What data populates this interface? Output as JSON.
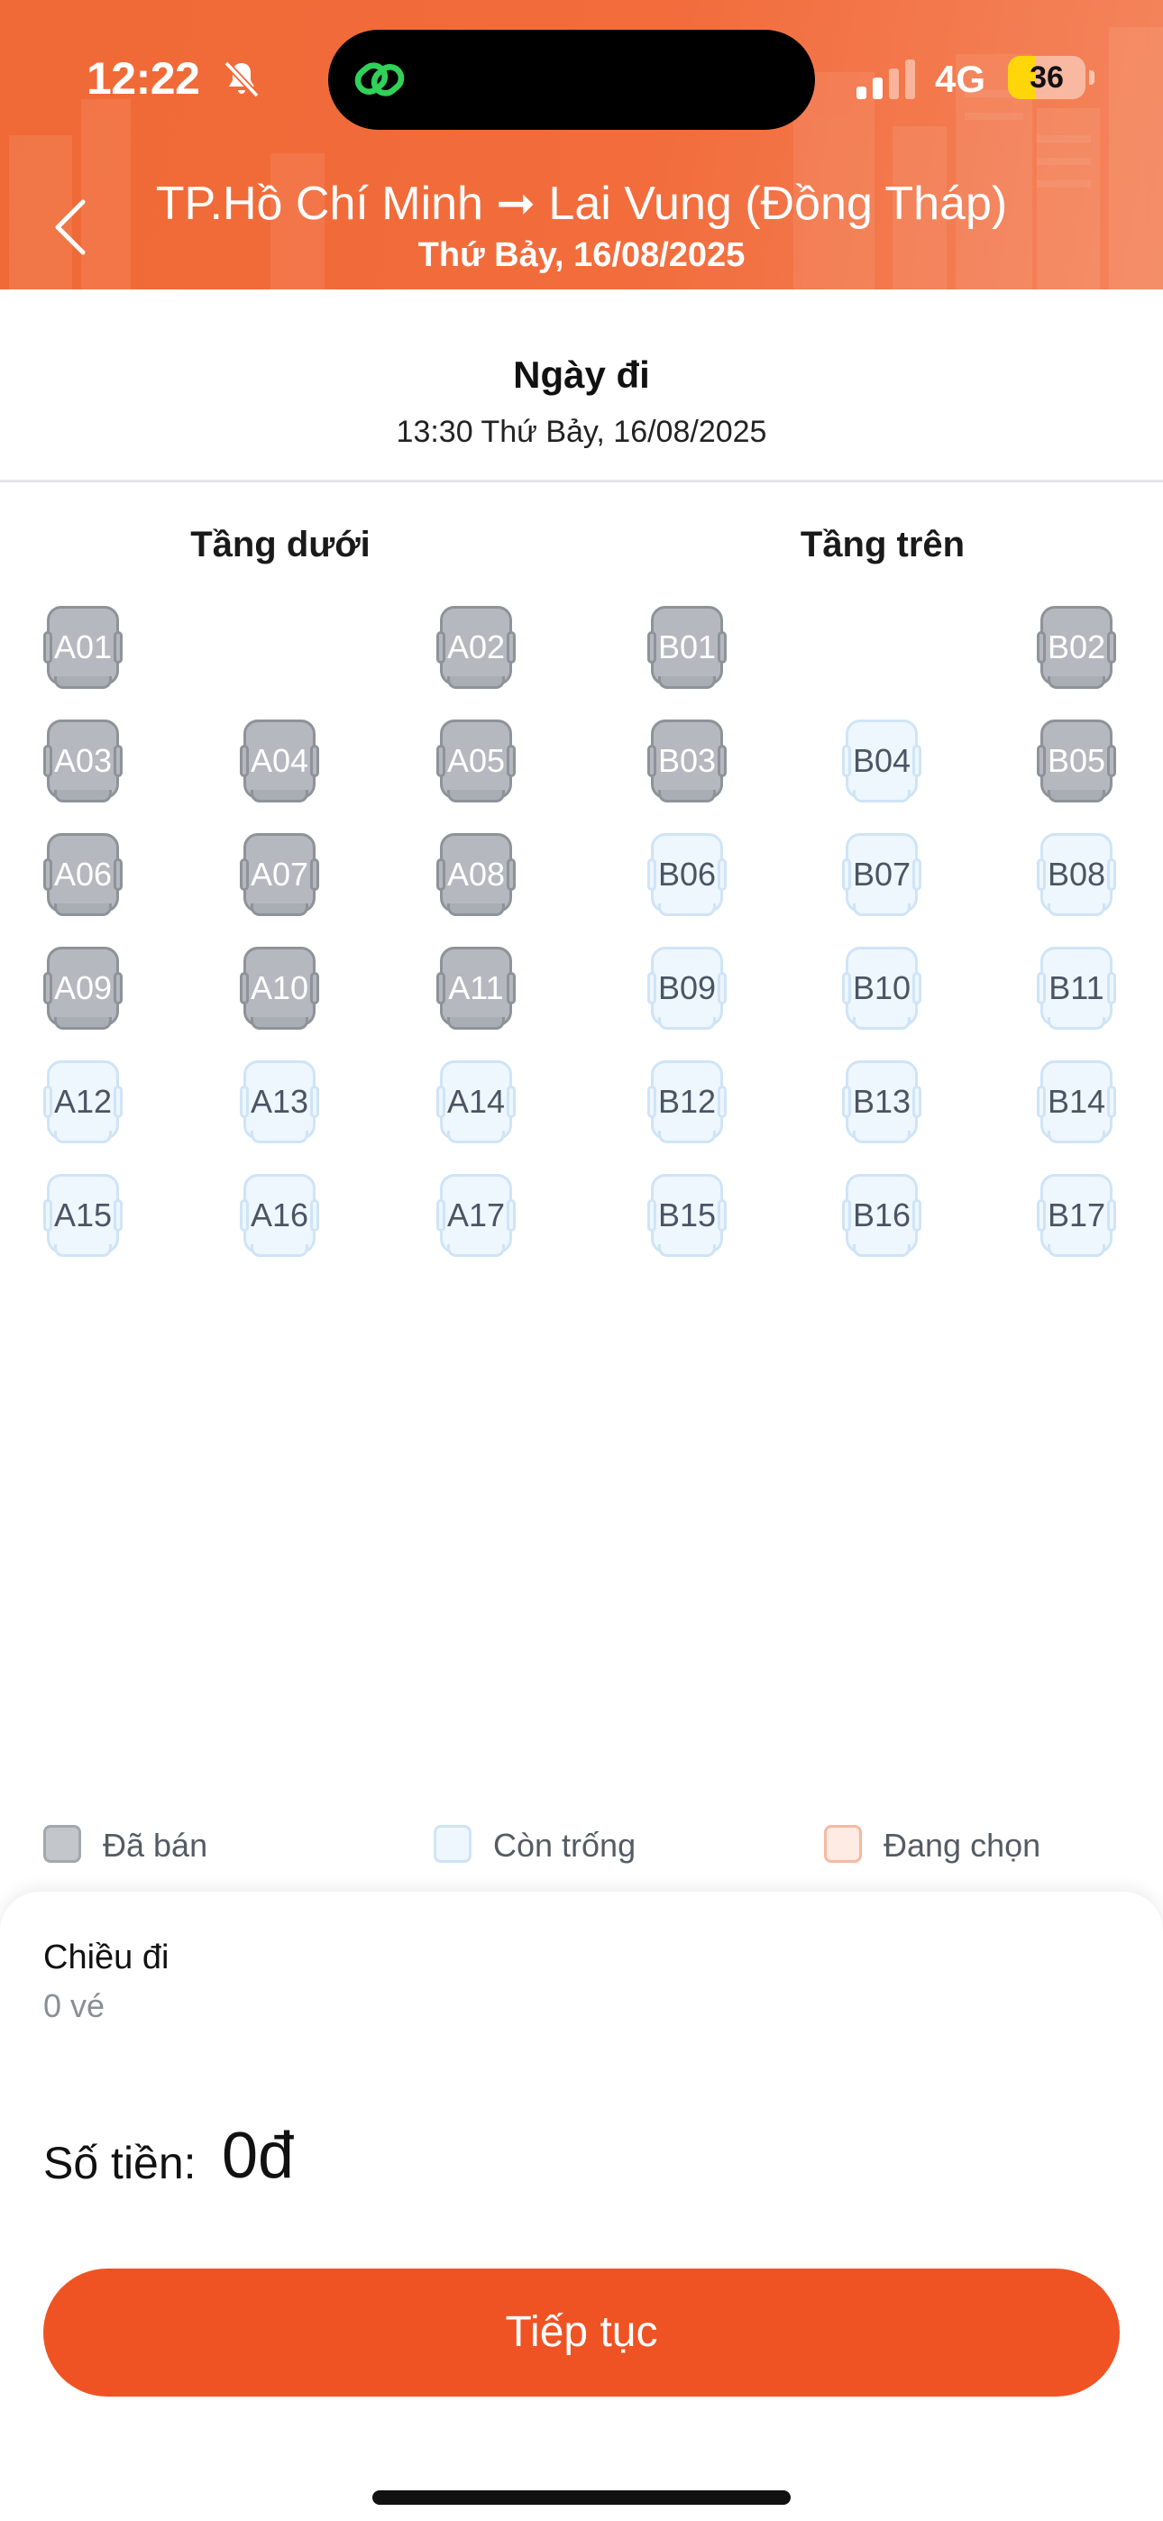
{
  "status_bar": {
    "time": "12:22",
    "network": "4G",
    "battery": "36",
    "battery_level_percent": 36,
    "battery_color": "#ffd60a",
    "icons": [
      "bell-slash-icon",
      "app-logo-icon",
      "cellular-signal-icon"
    ]
  },
  "header": {
    "route": "TP.Hồ Chí Minh ➞ Lai Vung (Đồng Tháp)",
    "date": "Thứ Bảy, 16/08/2025",
    "back_icon": "chevron-left-icon",
    "background_color": "#f06a37"
  },
  "trip": {
    "label": "Ngày đi",
    "datetime": "13:30 Thứ Bảy, 16/08/2025"
  },
  "seat_map": {
    "lower_deck": {
      "title": "Tầng dưới",
      "rows": [
        [
          {
            "id": "A01",
            "status": "sold"
          },
          null,
          {
            "id": "A02",
            "status": "sold"
          }
        ],
        [
          {
            "id": "A03",
            "status": "sold"
          },
          {
            "id": "A04",
            "status": "sold"
          },
          {
            "id": "A05",
            "status": "sold"
          }
        ],
        [
          {
            "id": "A06",
            "status": "sold"
          },
          {
            "id": "A07",
            "status": "sold"
          },
          {
            "id": "A08",
            "status": "sold"
          }
        ],
        [
          {
            "id": "A09",
            "status": "sold"
          },
          {
            "id": "A10",
            "status": "sold"
          },
          {
            "id": "A11",
            "status": "sold"
          }
        ],
        [
          {
            "id": "A12",
            "status": "free"
          },
          {
            "id": "A13",
            "status": "free"
          },
          {
            "id": "A14",
            "status": "free"
          }
        ],
        [
          {
            "id": "A15",
            "status": "free"
          },
          {
            "id": "A16",
            "status": "free"
          },
          {
            "id": "A17",
            "status": "free"
          }
        ]
      ]
    },
    "upper_deck": {
      "title": "Tầng trên",
      "rows": [
        [
          {
            "id": "B01",
            "status": "sold"
          },
          null,
          {
            "id": "B02",
            "status": "sold"
          }
        ],
        [
          {
            "id": "B03",
            "status": "sold"
          },
          {
            "id": "B04",
            "status": "free"
          },
          {
            "id": "B05",
            "status": "sold"
          }
        ],
        [
          {
            "id": "B06",
            "status": "free"
          },
          {
            "id": "B07",
            "status": "free"
          },
          {
            "id": "B08",
            "status": "free"
          }
        ],
        [
          {
            "id": "B09",
            "status": "free"
          },
          {
            "id": "B10",
            "status": "free"
          },
          {
            "id": "B11",
            "status": "free"
          }
        ],
        [
          {
            "id": "B12",
            "status": "free"
          },
          {
            "id": "B13",
            "status": "free"
          },
          {
            "id": "B14",
            "status": "free"
          }
        ],
        [
          {
            "id": "B15",
            "status": "free"
          },
          {
            "id": "B16",
            "status": "free"
          },
          {
            "id": "B17",
            "status": "free"
          }
        ]
      ]
    }
  },
  "legend": [
    {
      "key": "sold",
      "label": "Đã bán",
      "color": "#c3c6cb",
      "border": "#a3a8ae"
    },
    {
      "key": "free",
      "label": "Còn trống",
      "color": "#eef6fe",
      "border": "#cfe4f7"
    },
    {
      "key": "selected",
      "label": "Đang chọn",
      "color": "#fdebe4",
      "border": "#f5b9a2"
    }
  ],
  "summary": {
    "direction": "Chiều đi",
    "tickets": "0 vé",
    "price_label": "Số tiền:",
    "price_value": "0đ",
    "button_label": "Tiếp tục",
    "button_color": "#ef5323"
  }
}
